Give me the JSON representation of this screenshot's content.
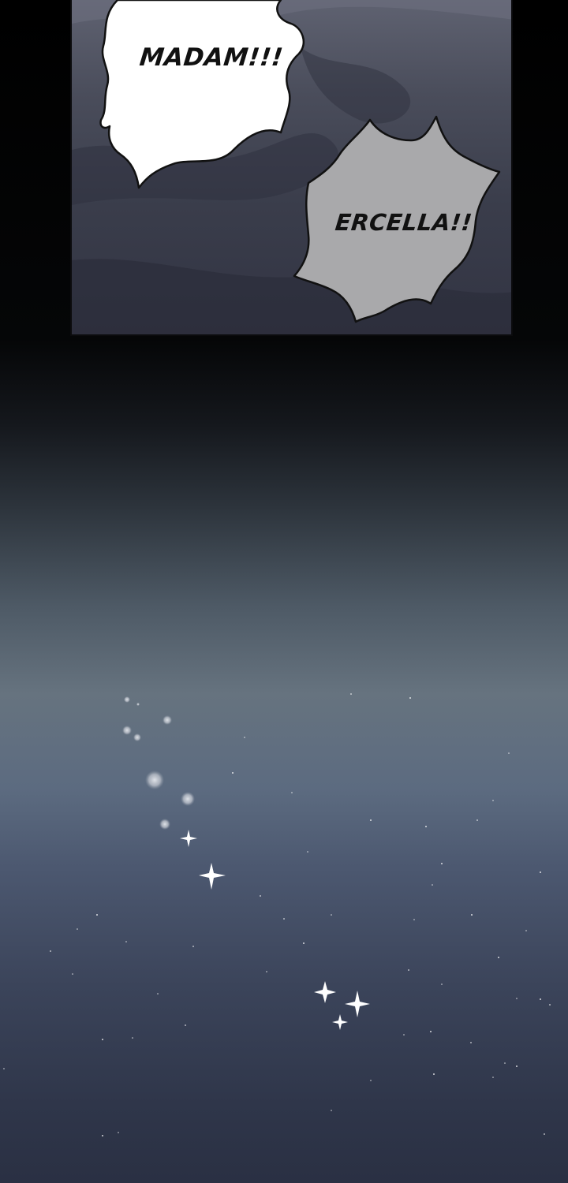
{
  "panel": {
    "bubbles": [
      {
        "text": "MADAM!!!"
      },
      {
        "text": "ERCELLA!!"
      }
    ]
  },
  "colors": {
    "bubble_primary": "#ffffff",
    "bubble_secondary": "#a9a9ab",
    "outline": "#111111",
    "sky_top": "#000000",
    "sky_mid": "#66737f",
    "sky_bottom": "#2a3043",
    "sparkle": "#ffffff"
  },
  "decorations": {
    "sparkle_icon": "four-point-star-icon",
    "glow_icon": "light-orb-icon"
  }
}
